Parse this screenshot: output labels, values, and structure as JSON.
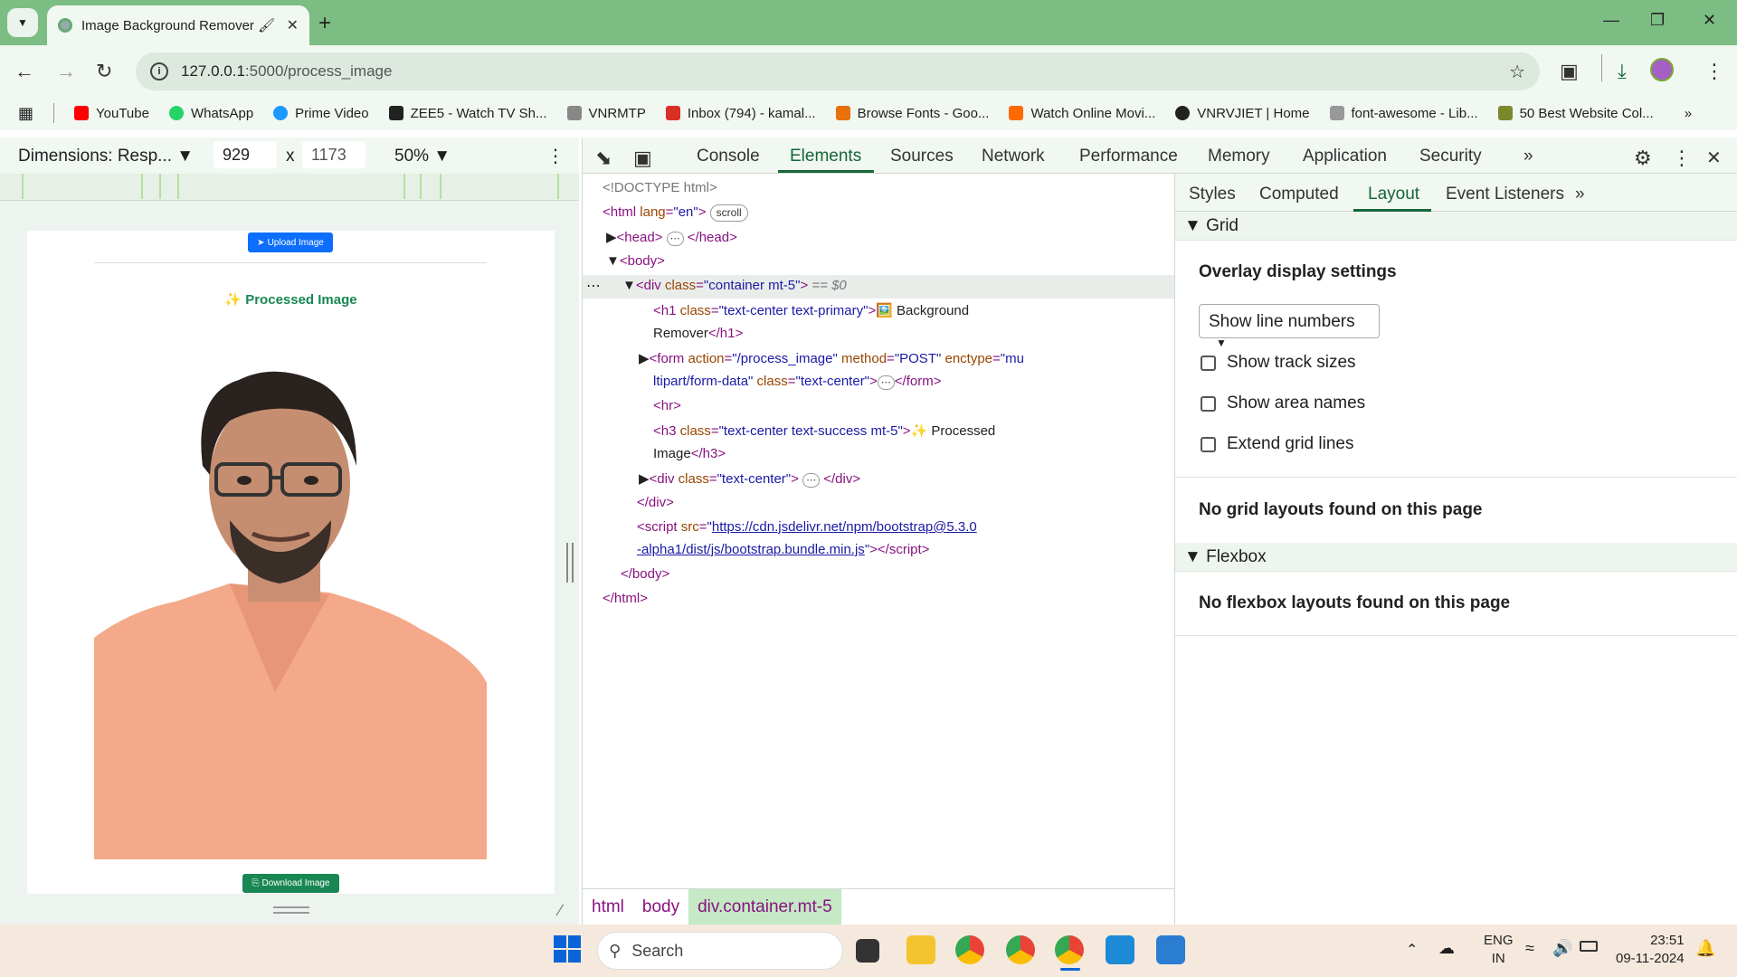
{
  "browser": {
    "tab_title": "Image Background Remover 🖌",
    "url_host": "127.0.0.1",
    "url_path": ":5000/process_image",
    "bookmarks": [
      "YouTube",
      "WhatsApp",
      "Prime Video",
      "ZEE5 - Watch TV Sh...",
      "VNRMTP",
      "Inbox (794) - kamal...",
      "Browse Fonts - Goo...",
      "Watch Online Movi...",
      "VNRVJIET | Home",
      "font-awesome - Lib...",
      "50 Best Website Col..."
    ],
    "bookmark_colors": [
      "#ff0000",
      "#25d366",
      "#1a98ff",
      "#222222",
      "#888888",
      "#d93025",
      "#e8710a",
      "#ff6a00",
      "#222222",
      "#999999",
      "#7a8a2a"
    ]
  },
  "device_toolbar": {
    "dimensions": "Dimensions: Resp...",
    "width": "929",
    "times": "x",
    "height": "1173",
    "zoom": "50%"
  },
  "page": {
    "upload_label": "Upload Image",
    "processed_heading": "✨ Processed Image",
    "download_label": "Download Image"
  },
  "devtools": {
    "tabs": [
      "Console",
      "Elements",
      "Sources",
      "Network",
      "Performance",
      "Memory",
      "Application",
      "Security"
    ],
    "active_tab": "Elements",
    "doctype": "<!DOCTYPE html>",
    "scroll_badge": "scroll",
    "selected_suffix": "== $0",
    "h1_text_1": "🖼️ Background",
    "h1_text_2": "Remover",
    "form_action": "\"/process_image\"",
    "form_method": "\"POST\"",
    "form_enctype_1": "\"mu",
    "form_enctype_2": "ltipart/form-data\"",
    "h3_text_1": "✨ Processed",
    "h3_text_2": "Image",
    "script_src_1": "https://cdn.jsdelivr.net/npm/bootstrap@5.3.0",
    "script_src_2": "-alpha1/dist/js/bootstrap.bundle.min.js",
    "breadcrumbs": [
      "html",
      "body",
      "div.container.mt-5"
    ]
  },
  "sidebar": {
    "tabs": [
      "Styles",
      "Computed",
      "Layout",
      "Event Listeners"
    ],
    "active_tab": "Layout",
    "grid_header": "Grid",
    "overlay_title": "Overlay display settings",
    "line_numbers_option": "Show line numbers",
    "checkboxes": [
      "Show track sizes",
      "Show area names",
      "Extend grid lines"
    ],
    "no_grid": "No grid layouts found on this page",
    "flexbox_header": "Flexbox",
    "no_flex": "No flexbox layouts found on this page"
  },
  "taskbar": {
    "search_placeholder": "Search",
    "lang_1": "ENG",
    "lang_2": "IN",
    "time": "23:51",
    "date": "09-11-2024"
  }
}
